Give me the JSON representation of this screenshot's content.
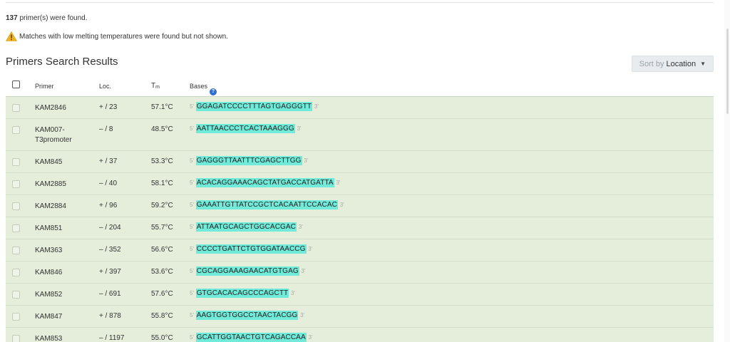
{
  "summary": {
    "count": "137",
    "found_text": " primer(s) were found.",
    "warning_text": "Matches with low melting temperatures were found but not shown."
  },
  "section_title": "Primers Search Results",
  "sort": {
    "prefix": "Sort by",
    "value": "Location"
  },
  "columns": {
    "primer": "Primer",
    "loc": "Loc.",
    "tm_main": "T",
    "tm_sub": "m",
    "bases": "Bases"
  },
  "labels": {
    "five_prime": "5'",
    "three_prime": "3'"
  },
  "colors": {
    "match_highlight": "#70ead9",
    "row_background": "#e4eedb",
    "help_icon": "#2f6fd1",
    "warning_icon": "#f2b21f"
  },
  "rows": [
    {
      "primer": "KAM2846",
      "loc": "+ / 23",
      "tm": "57.1°C",
      "seq": "GGAGATCCCCTTTAGTGAGGGTT"
    },
    {
      "primer": "KAM007-T3promoter",
      "primer_line1": "KAM007-",
      "primer_line2": "T3promoter",
      "loc": "– / 8",
      "tm": "48.5°C",
      "seq": "AATTAACCCTCACTAAAGGG"
    },
    {
      "primer": "KAM845",
      "loc": "+ / 37",
      "tm": "53.3°C",
      "seq": "GAGGGTTAATTTCGAGCTTGG"
    },
    {
      "primer": "KAM2885",
      "loc": "– / 40",
      "tm": "58.1°C",
      "seq": "ACACAGGAAACAGCTATGACCATGATTA"
    },
    {
      "primer": "KAM2884",
      "loc": "+ / 96",
      "tm": "59.2°C",
      "seq": "GAAATTGTTATCCGCTCACAATTCCACAC"
    },
    {
      "primer": "KAM851",
      "loc": "– / 204",
      "tm": "55.7°C",
      "seq": "ATTAATGCAGCTGGCACGAC"
    },
    {
      "primer": "KAM363",
      "loc": "– / 352",
      "tm": "56.6°C",
      "seq": "CCCCTGATTCTGTGGATAACCG"
    },
    {
      "primer": "KAM846",
      "loc": "+ / 397",
      "tm": "53.6°C",
      "seq": "CGCAGGAAAGAACATGTGAG"
    },
    {
      "primer": "KAM852",
      "loc": "– / 691",
      "tm": "57.6°C",
      "seq": "GTGCACACAGCCCAGCTT"
    },
    {
      "primer": "KAM847",
      "loc": "+ / 878",
      "tm": "55.8°C",
      "seq": "AAGTGGTGGCCTAACTACGG"
    },
    {
      "primer": "KAM853",
      "loc": "– / 1197",
      "tm": "55.0°C",
      "seq": "GCATTGGTAACTGTCAGACCAA"
    }
  ]
}
